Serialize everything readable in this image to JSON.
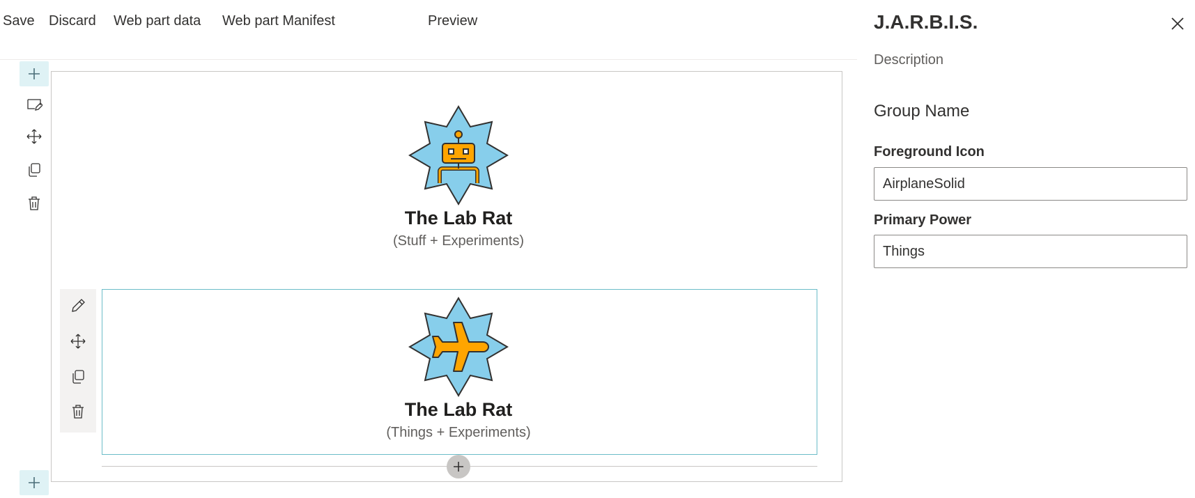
{
  "toolbar": {
    "save": "Save",
    "discard": "Discard",
    "web_part_data": "Web part data",
    "web_part_manifest": "Web part Manifest",
    "preview": "Preview"
  },
  "web_parts": [
    {
      "title": "The Lab Rat",
      "subtitle": "(Stuff + Experiments)",
      "icon": "robot-icon"
    },
    {
      "title": "The Lab Rat",
      "subtitle": "(Things + Experiments)",
      "icon": "airplane-icon"
    }
  ],
  "panel": {
    "title": "J.A.R.B.I.S.",
    "description": "Description",
    "group_name": "Group Name",
    "foreground_icon_label": "Foreground Icon",
    "foreground_icon_value": "AirplaneSolid",
    "primary_power_label": "Primary Power",
    "primary_power_value": "Things"
  },
  "colors": {
    "star_fill": "#87ceeb",
    "icon_fill": "#ffa500",
    "accent": "#6bbcc8"
  }
}
